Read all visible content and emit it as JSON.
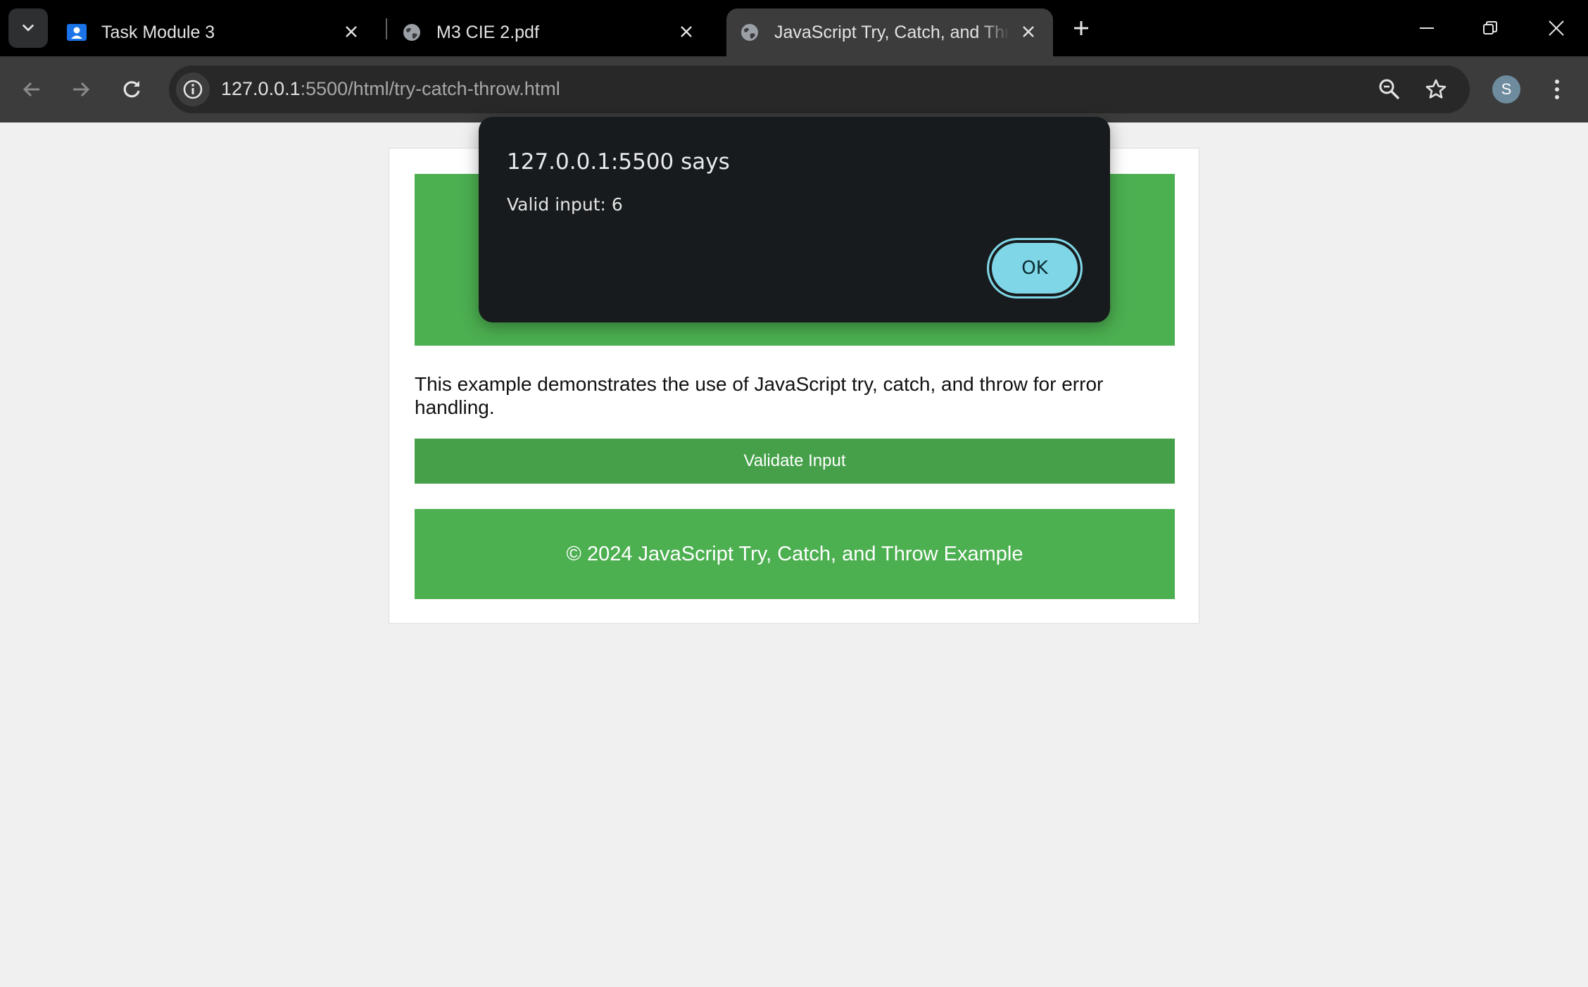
{
  "browser": {
    "tabs": [
      {
        "title": "Task Module 3",
        "icon": "classroom-icon"
      },
      {
        "title": "M3 CIE 2.pdf",
        "icon": "globe-icon"
      },
      {
        "title": "JavaScript Try, Catch, and Throw Example",
        "icon": "globe-icon",
        "active": true
      }
    ],
    "omnibox": {
      "url_host": "127.0.0.1",
      "url_rest": ":5500/html/try-catch-throw.html"
    },
    "profile_initial": "S"
  },
  "page": {
    "description": "This example demonstrates the use of JavaScript try, catch, and throw for error handling.",
    "validate_button": "Validate Input",
    "footer": "© 2024 JavaScript Try, Catch, and Throw Example",
    "colors": {
      "primary": "#4caf50",
      "button": "#45a049",
      "background": "#f0f0f0"
    }
  },
  "alert": {
    "title": "127.0.0.1:5500 says",
    "message": "Valid input: 6",
    "ok_label": "OK",
    "accent": "#7fd6e6"
  }
}
